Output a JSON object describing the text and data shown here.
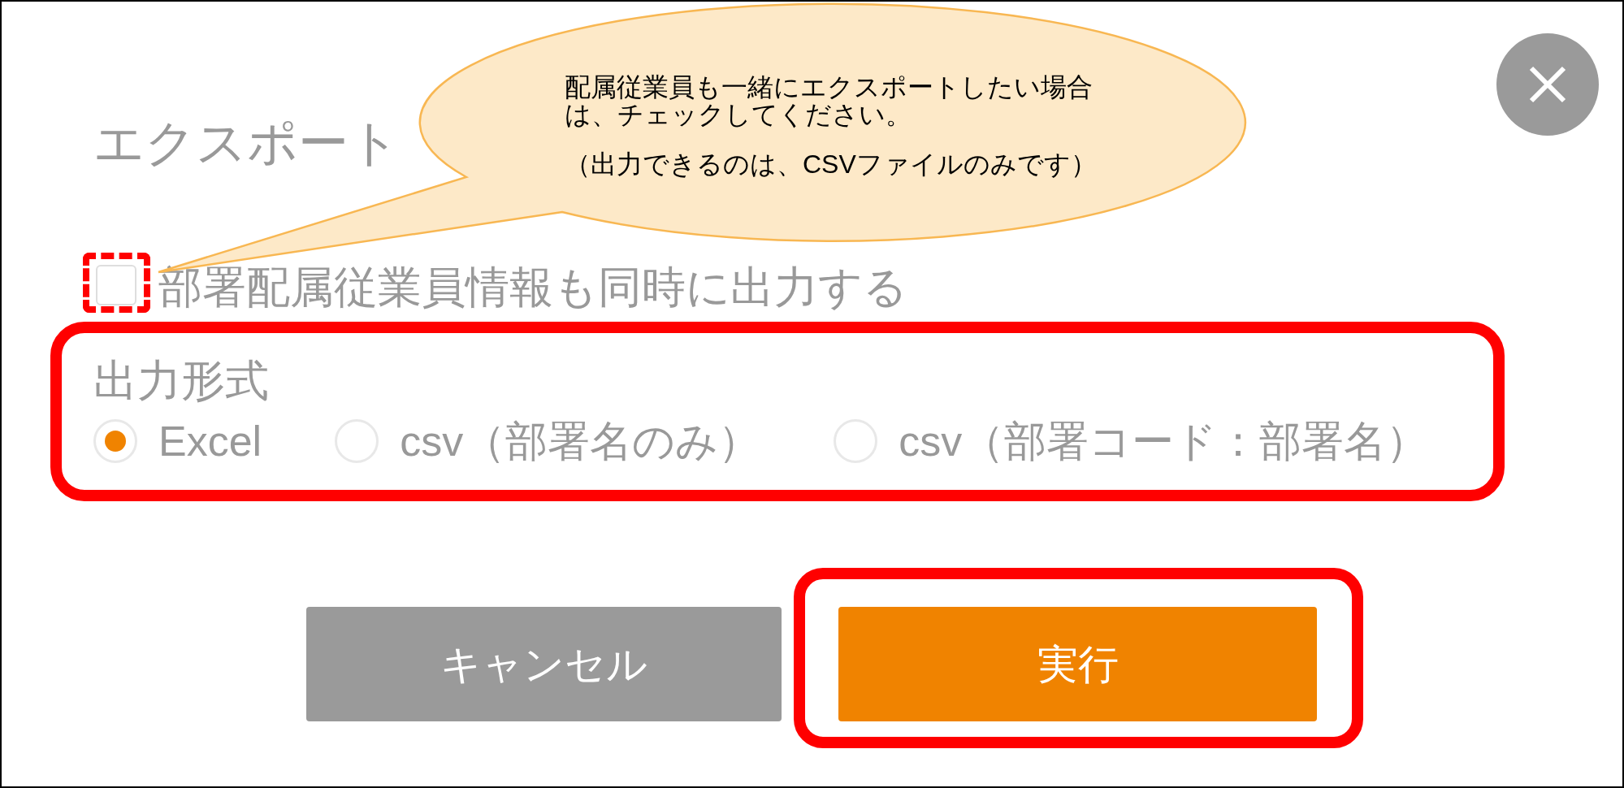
{
  "dialog": {
    "title": "エクスポート"
  },
  "callout": {
    "lines": [
      "配属従業員も一緒にエクスポートしたい場合",
      "は、チェックしてください。"
    ],
    "note": "（出力できるのは、CSVファイルのみです）"
  },
  "include_employees": {
    "label": "部署配属従業員情報も同時に出力する",
    "checked": false,
    "highlighted": true
  },
  "output_format": {
    "label": "出力形式",
    "highlighted": true,
    "options": [
      {
        "label": "Excel",
        "selected": true
      },
      {
        "label": "csv（部署名のみ）",
        "selected": false
      },
      {
        "label": "csv（部署コード：部署名）",
        "selected": false
      }
    ]
  },
  "buttons": [
    {
      "label": "キャンセル",
      "kind": "secondary",
      "highlighted": false
    },
    {
      "label": "実行",
      "kind": "primary",
      "highlighted": true
    }
  ]
}
